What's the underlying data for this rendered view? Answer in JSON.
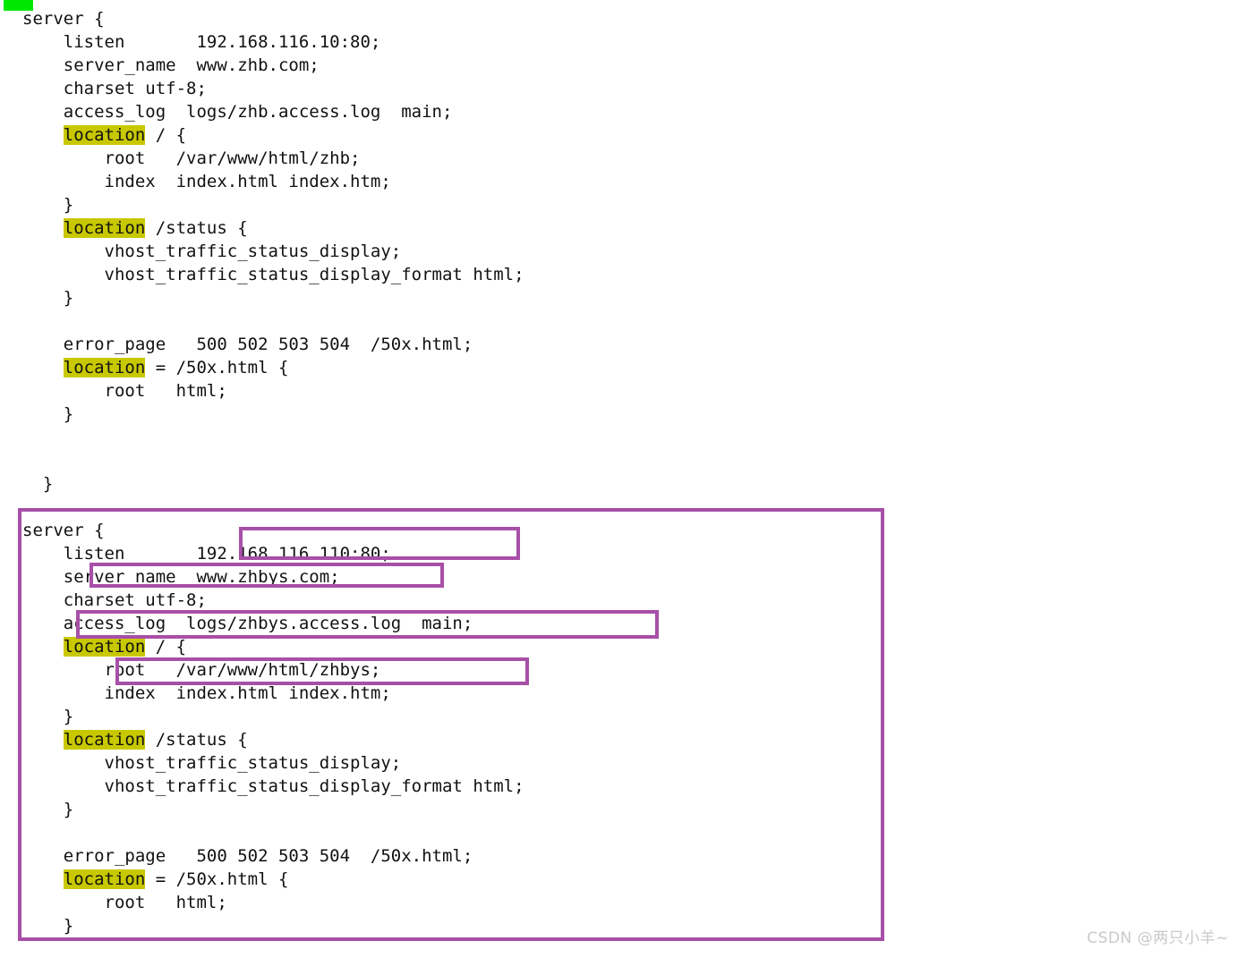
{
  "colors": {
    "highlight": "#c8c800",
    "annotation_border": "#a84fa8",
    "green_mark": "#00e800",
    "text": "#111111",
    "background": "#ffffff",
    "watermark": "#c9c9c9"
  },
  "block1": {
    "title": "nginx server block for www.zhb.com",
    "lines": [
      [
        {
          "t": "server {"
        }
      ],
      [
        {
          "t": "    listen       192.168.116.10:80;"
        }
      ],
      [
        {
          "t": "    server_name  www.zhb.com;"
        }
      ],
      [
        {
          "t": "    charset utf-8;"
        }
      ],
      [
        {
          "t": "    access_log  logs/zhb.access.log  main;"
        }
      ],
      [
        {
          "t": "    "
        },
        {
          "t": "location",
          "hl": true
        },
        {
          "t": " / {"
        }
      ],
      [
        {
          "t": "        root   /var/www/html/zhb;"
        }
      ],
      [
        {
          "t": "        index  index.html index.htm;"
        }
      ],
      [
        {
          "t": "    }"
        }
      ],
      [
        {
          "t": "    "
        },
        {
          "t": "location",
          "hl": true
        },
        {
          "t": " /status {"
        }
      ],
      [
        {
          "t": "        vhost_traffic_status_display;"
        }
      ],
      [
        {
          "t": "        vhost_traffic_status_display_format html;"
        }
      ],
      [
        {
          "t": "    }"
        }
      ],
      [
        {
          "t": ""
        }
      ],
      [
        {
          "t": "    error_page   500 502 503 504  /50x.html;"
        }
      ],
      [
        {
          "t": "    "
        },
        {
          "t": "location",
          "hl": true
        },
        {
          "t": " = /50x.html {"
        }
      ],
      [
        {
          "t": "        root   html;"
        }
      ],
      [
        {
          "t": "    }"
        }
      ],
      [
        {
          "t": ""
        }
      ],
      [
        {
          "t": ""
        }
      ],
      [
        {
          "t": "  }"
        }
      ]
    ]
  },
  "block2": {
    "title": "nginx server block for www.zhbys.com",
    "lines": [
      [
        {
          "t": "server {"
        }
      ],
      [
        {
          "t": "    listen       192.168.116.110:80;"
        }
      ],
      [
        {
          "t": "    server_name  www.zhbys.com;"
        }
      ],
      [
        {
          "t": "    charset utf-8;"
        }
      ],
      [
        {
          "t": "    access_log  logs/zhbys.access.log  main;"
        }
      ],
      [
        {
          "t": "    "
        },
        {
          "t": "location",
          "hl": true
        },
        {
          "t": " / {"
        }
      ],
      [
        {
          "t": "        root   /var/www/html/zhbys;"
        }
      ],
      [
        {
          "t": "        index  index.html index.htm;"
        }
      ],
      [
        {
          "t": "    }"
        }
      ],
      [
        {
          "t": "    "
        },
        {
          "t": "location",
          "hl": true
        },
        {
          "t": " /status {"
        }
      ],
      [
        {
          "t": "        vhost_traffic_status_display;"
        }
      ],
      [
        {
          "t": "        vhost_traffic_status_display_format html;"
        }
      ],
      [
        {
          "t": "    }"
        }
      ],
      [
        {
          "t": ""
        }
      ],
      [
        {
          "t": "    error_page   500 502 503 504  /50x.html;"
        }
      ],
      [
        {
          "t": "    "
        },
        {
          "t": "location",
          "hl": true
        },
        {
          "t": " = /50x.html {"
        }
      ],
      [
        {
          "t": "        root   html;"
        }
      ],
      [
        {
          "t": "    }"
        }
      ]
    ]
  },
  "annotations": {
    "listen": "192.168.116.110:80;",
    "server_name": "server_name  www.zhbys.com;",
    "access_log": "access_log  logs/zhbys.access.log  main;",
    "root": "root   /var/www/html/zhbys;"
  },
  "watermark": {
    "text": "CSDN @两只小羊~"
  }
}
